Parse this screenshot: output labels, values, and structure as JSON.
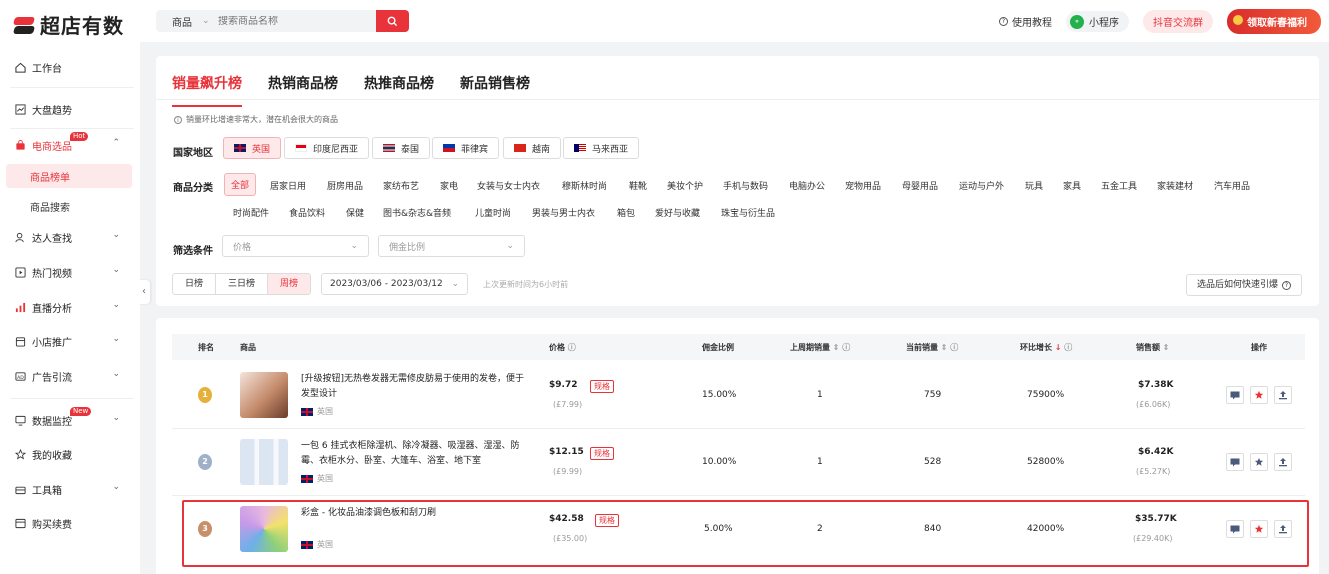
{
  "brand": {
    "name": "超店有数",
    "color": "#e8333a"
  },
  "search": {
    "type": "商品",
    "placeholder": "搜索商品名称"
  },
  "header": {
    "help": "使用教程",
    "mini_program": "小程序",
    "douyin": "抖音交流群",
    "gift": "领取新春福利"
  },
  "sidebar": {
    "items": [
      {
        "label": "工作台",
        "icon": "home-icon"
      },
      {
        "label": "大盘趋势",
        "icon": "trend-icon"
      },
      {
        "label": "电商选品",
        "icon": "bag-icon",
        "badge": "Hot"
      },
      {
        "label": "达人查找",
        "icon": "user-search-icon"
      },
      {
        "label": "热门视频",
        "icon": "video-icon"
      },
      {
        "label": "直播分析",
        "icon": "bar-chart-icon"
      },
      {
        "label": "小店推广",
        "icon": "shop-icon"
      },
      {
        "label": "广告引流",
        "icon": "ad-icon"
      },
      {
        "label": "数据监控",
        "icon": "monitor-icon",
        "badge": "New"
      },
      {
        "label": "我的收藏",
        "icon": "star-icon"
      },
      {
        "label": "工具箱",
        "icon": "toolbox-icon"
      },
      {
        "label": "购买续费",
        "icon": "cart-icon"
      }
    ],
    "subs": [
      "商品榜单",
      "商品搜索"
    ]
  },
  "tabs": [
    "销量飙升榜",
    "热销商品榜",
    "热推商品榜",
    "新品销售榜"
  ],
  "hint": "销量环比增速非常大，潜在机会很大的商品",
  "labels": {
    "country": "国家地区",
    "category": "商品分类",
    "filter": "筛选条件"
  },
  "countries": [
    "英国",
    "印度尼西亚",
    "泰国",
    "菲律宾",
    "越南",
    "马来西亚"
  ],
  "categories": [
    "全部",
    "居家日用",
    "厨房用品",
    "家纺布艺",
    "家电",
    "女装与女士内衣",
    "穆斯林时尚",
    "鞋靴",
    "美妆个护",
    "手机与数码",
    "电脑办公",
    "宠物用品",
    "母婴用品",
    "运动与户外",
    "玩具",
    "家具",
    "五金工具",
    "家装建材",
    "汽车用品",
    "时尚配件",
    "食品饮料",
    "保健",
    "图书&杂志&音频",
    "儿童时尚",
    "男装与男士内衣",
    "箱包",
    "爱好与收藏",
    "珠宝与衍生品"
  ],
  "filters": {
    "price": "价格",
    "commission": "佣金比例"
  },
  "period": {
    "options": [
      "日榜",
      "三日榜",
      "周榜"
    ],
    "date": "2023/03/06 - 2023/03/12",
    "update": "上次更新时间为6小时前",
    "howto": "选品后如何快速引爆"
  },
  "table": {
    "headers": [
      "排名",
      "商品",
      "价格",
      "佣金比例",
      "上周期销量",
      "当前销量",
      "环比增长",
      "销售额",
      "操作"
    ],
    "spec_label": "规格",
    "rows": [
      {
        "rank": "1",
        "name": "[升级按钮]无热卷发器无需修皮肪易于使用的发卷，便于发型设计",
        "country": "英国",
        "price": "$9.72",
        "price_local": "(£7.99)",
        "commission": "15.00%",
        "prev": "1",
        "curr": "759",
        "growth": "75900%",
        "sales": "$7.38K",
        "sales_local": "(£6.06K)"
      },
      {
        "rank": "2",
        "name": "一包 6 挂式衣柜除湿机、除冷凝器、吸湿器、湿湿、防霉、衣柜水分、卧室、大篷车、浴室、地下室",
        "country": "英国",
        "price": "$12.15",
        "price_local": "(£9.99)",
        "commission": "10.00%",
        "prev": "1",
        "curr": "528",
        "growth": "52800%",
        "sales": "$6.42K",
        "sales_local": "(£5.27K)"
      },
      {
        "rank": "3",
        "name": "彩盒 - 化妆品油漆调色板和刮刀刷",
        "country": "英国",
        "price": "$42.58",
        "price_local": "(£35.00)",
        "commission": "5.00%",
        "prev": "2",
        "curr": "840",
        "growth": "42000%",
        "sales": "$35.77K",
        "sales_local": "(£29.40K)"
      }
    ]
  }
}
